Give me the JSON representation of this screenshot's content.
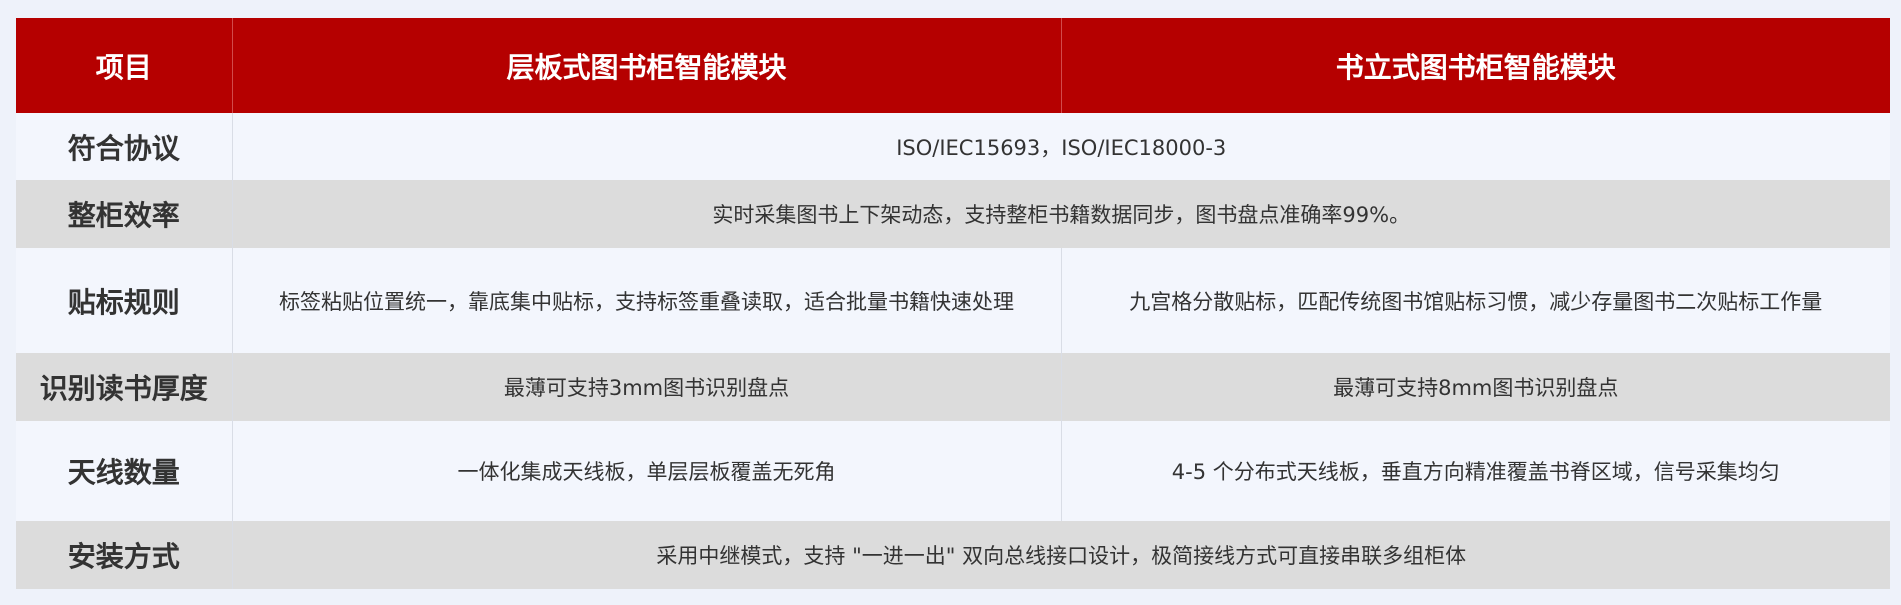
{
  "header": {
    "item": "项目",
    "shelf_module": "层板式图书柜智能模块",
    "upright_module": "书立式图书柜智能模块"
  },
  "rows": [
    {
      "label": "符合协议",
      "merged": "ISO/IEC15693，ISO/IEC18000-3"
    },
    {
      "label": "整柜效率",
      "merged": "实时采集图书上下架动态，支持整柜书籍数据同步，图书盘点准确率99%。"
    },
    {
      "label": "贴标规则",
      "shelf": "标签粘贴位置统一，靠底集中贴标，支持标签重叠读取，适合批量书籍快速处理",
      "upright": "九宫格分散贴标，匹配传统图书馆贴标习惯，减少存量图书二次贴标工作量"
    },
    {
      "label": "识别读书厚度",
      "shelf": "最薄可支持3mm图书识别盘点",
      "upright": "最薄可支持8mm图书识别盘点"
    },
    {
      "label": "天线数量",
      "shelf": "一体化集成天线板，单层层板覆盖无死角",
      "upright": "4-5 个分布式天线板，垂直方向精准覆盖书脊区域，信号采集均匀"
    },
    {
      "label": "安装方式",
      "merged": "采用中继模式，支持 \"一进一出\" 双向总线接口设计，极简接线方式可直接串联多组柜体"
    }
  ],
  "colors": {
    "header_bg": "#b50000",
    "header_text": "#ffffff",
    "row_light": "#f3f6fd",
    "row_gray": "#dcdcdc"
  }
}
